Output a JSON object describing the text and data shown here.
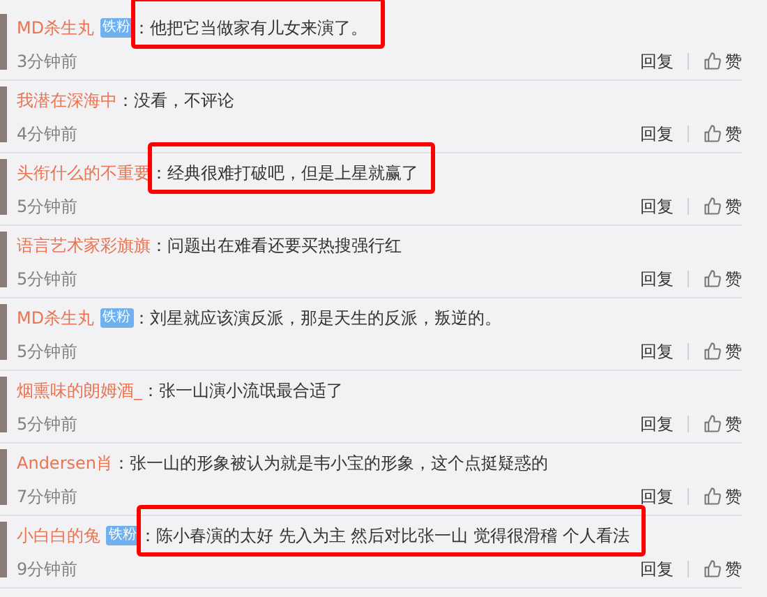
{
  "comments": [
    {
      "name": "MD杀生丸",
      "badge": "铁粉",
      "text": "：他把它当做家有儿女来演了。",
      "time": "3分钟前",
      "reply": "回复",
      "like": "赞",
      "highlighted": true
    },
    {
      "name": "我潜在深海中",
      "text": "：没看，不评论",
      "time": "4分钟前",
      "reply": "回复",
      "like": "赞",
      "highlighted": false
    },
    {
      "name": "头衔什么的不重要",
      "text": "：经典很难打破吧，但是上星就赢了",
      "time": "5分钟前",
      "reply": "回复",
      "like": "赞",
      "highlighted": true
    },
    {
      "name": "语言艺术家彩旗旗",
      "text": "：问题出在难看还要买热搜强行红",
      "time": "5分钟前",
      "reply": "回复",
      "like": "赞",
      "highlighted": false
    },
    {
      "name": "MD杀生丸",
      "badge": "铁粉",
      "text": "：刘星就应该演反派，那是天生的反派，叛逆的。",
      "time": "5分钟前",
      "reply": "回复",
      "like": "赞",
      "highlighted": false
    },
    {
      "name": "烟熏味的朗姆酒_",
      "text": "：张一山演小流氓最合适了",
      "time": "5分钟前",
      "reply": "回复",
      "like": "赞",
      "highlighted": false
    },
    {
      "name": "Andersen肖",
      "text": "：张一山的形象被认为就是韦小宝的形象，这个点挺疑惑的",
      "time": "7分钟前",
      "reply": "回复",
      "like": "赞",
      "highlighted": false
    },
    {
      "name": "小白白的兔",
      "badge": "铁粉",
      "text": "：陈小春演的太好 先入为主 然后对比张一山 觉得很滑稽 个人看法",
      "time": "9分钟前",
      "reply": "回复",
      "like": "赞",
      "highlighted": true
    }
  ]
}
